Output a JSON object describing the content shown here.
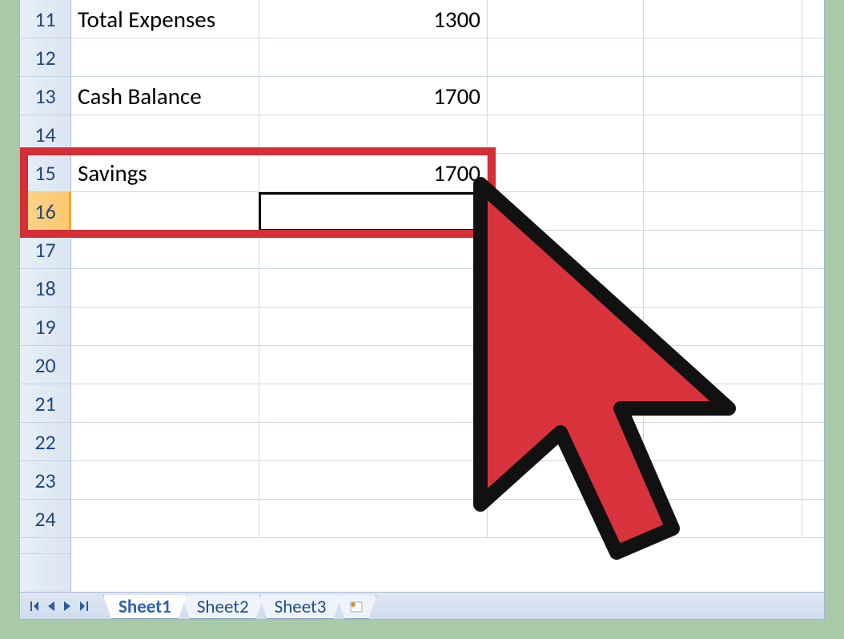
{
  "rows": {
    "start": 11,
    "end": 24,
    "active": 16,
    "data": {
      "11": {
        "A": "Total Expenses",
        "B": "1300"
      },
      "13": {
        "A": "Cash Balance",
        "B": "1700"
      },
      "15": {
        "A": "Savings",
        "B": "1700"
      }
    }
  },
  "sheets": [
    {
      "name": "Sheet1",
      "active": true
    },
    {
      "name": "Sheet2",
      "active": false
    },
    {
      "name": "Sheet3",
      "active": false
    }
  ],
  "overlay": {
    "highlight_rows": [
      15,
      16
    ]
  }
}
